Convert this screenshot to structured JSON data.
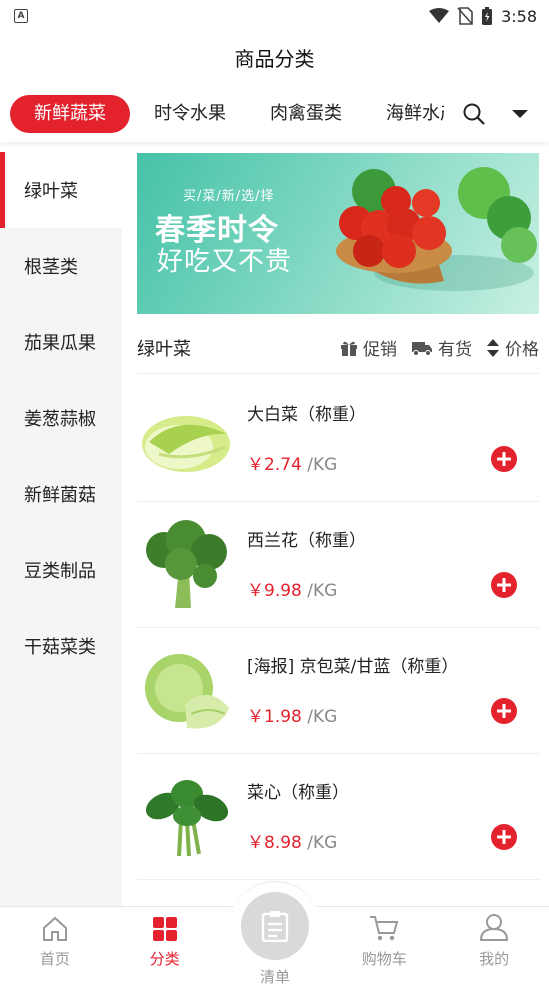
{
  "status": {
    "time": "3:58",
    "left_icon": "A"
  },
  "header": {
    "title": "商品分类"
  },
  "tabs": [
    {
      "label": "新鲜蔬菜",
      "active": true
    },
    {
      "label": "时令水果",
      "active": false
    },
    {
      "label": "肉禽蛋类",
      "active": false
    },
    {
      "label": "海鲜水产",
      "active": false
    }
  ],
  "sidebar": {
    "items": [
      {
        "label": "绿叶菜",
        "active": true
      },
      {
        "label": "根茎类"
      },
      {
        "label": "茄果瓜果"
      },
      {
        "label": "姜葱蒜椒"
      },
      {
        "label": "新鲜菌菇"
      },
      {
        "label": "豆类制品"
      },
      {
        "label": "干菇菜类"
      }
    ]
  },
  "banner": {
    "subtitle": "买/菜/新/选/择",
    "headline": "春季时令",
    "tagline": "好吃又不贵"
  },
  "filter_bar": {
    "title": "绿叶菜",
    "promo": "促销",
    "stock": "有货",
    "price": "价格"
  },
  "products": [
    {
      "name": "大白菜（称重）",
      "price": "￥2.74",
      "unit": "/KG",
      "icon": "napa-cabbage-image"
    },
    {
      "name": "西兰花（称重）",
      "price": "￥9.98",
      "unit": "/KG",
      "icon": "broccoli-image"
    },
    {
      "name": "[海报] 京包菜/甘蓝（称重）",
      "price": "￥1.98",
      "unit": "/KG",
      "icon": "cabbage-image"
    },
    {
      "name": "菜心（称重）",
      "price": "￥8.98",
      "unit": "/KG",
      "icon": "choy-sum-image"
    }
  ],
  "bottom_nav": {
    "home": "首页",
    "category": "分类",
    "list": "清单",
    "cart": "购物车",
    "mine": "我的"
  },
  "colors": {
    "accent": "#e3222e",
    "banner": "#45c2a7"
  }
}
